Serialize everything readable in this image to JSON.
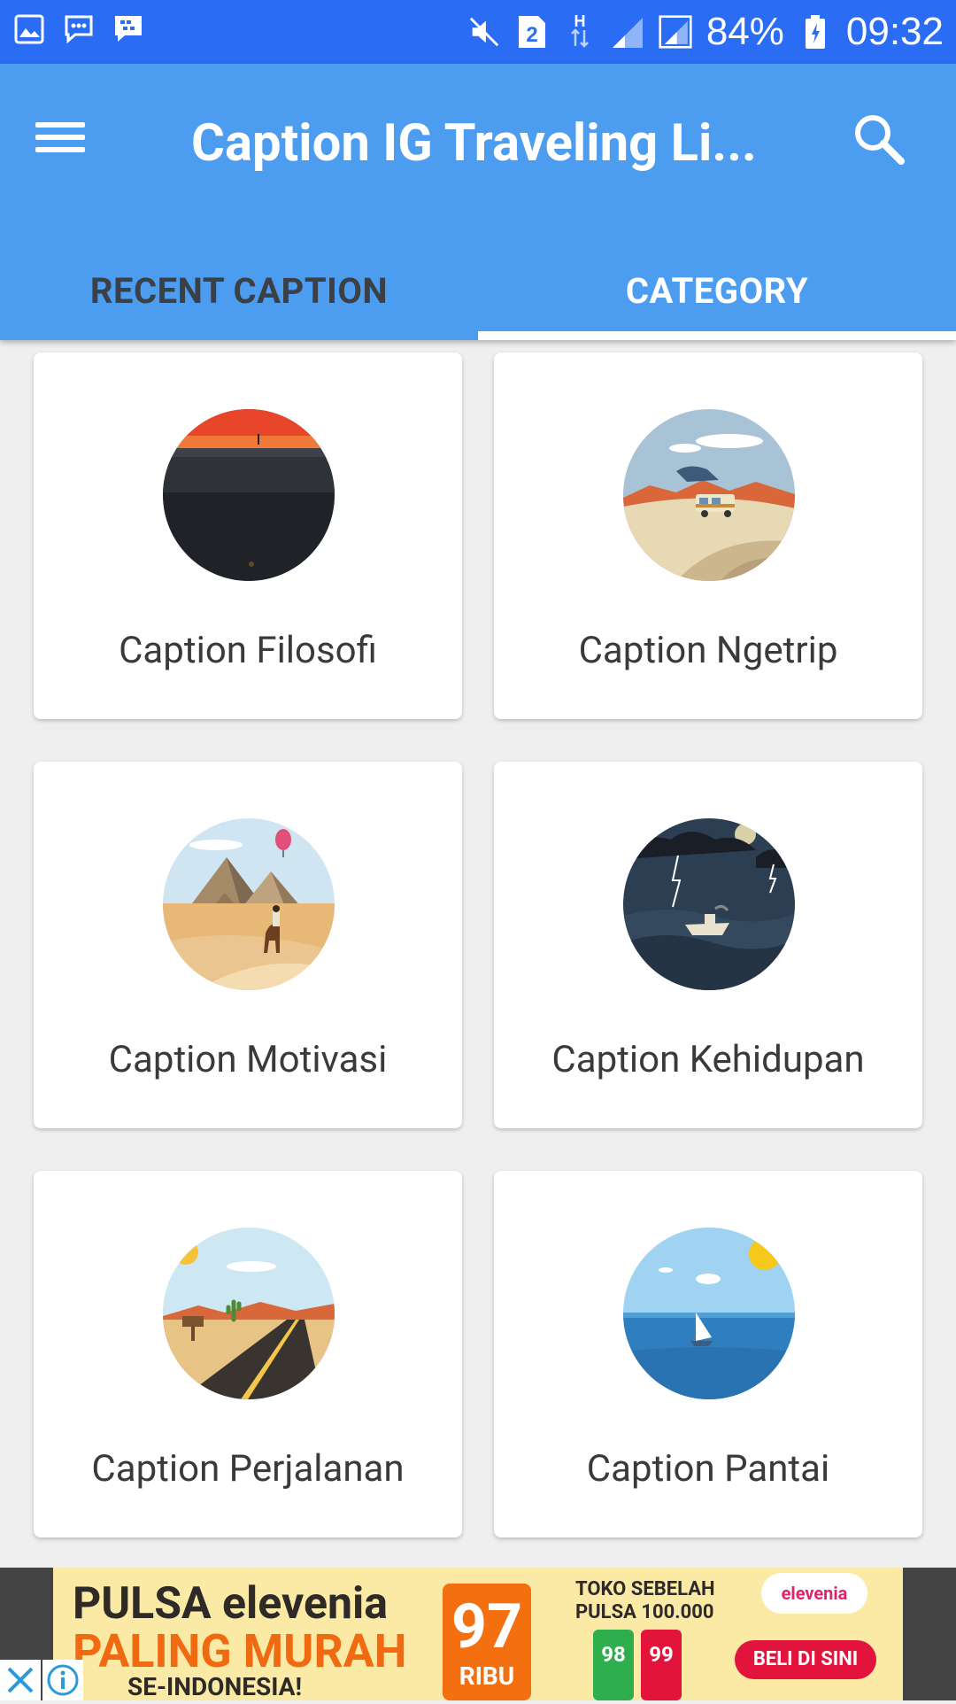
{
  "status_bar": {
    "battery": "84%",
    "time": "09:32",
    "sim_slot": "2",
    "network_type": "H",
    "icons": [
      "gallery-icon",
      "messaging-icon",
      "bbm-icon",
      "mute-icon",
      "sim-icon",
      "data-icon",
      "signal-icon",
      "signal-icon",
      "battery-icon"
    ]
  },
  "app_bar": {
    "title": "Caption IG Traveling Li...",
    "menu_icon": "hamburger-menu-icon",
    "search_icon": "search-icon",
    "tabs": [
      {
        "label": "RECENT CAPTION",
        "active": false
      },
      {
        "label": "CATEGORY",
        "active": true
      }
    ]
  },
  "categories": [
    {
      "label": "Caption Filosofi",
      "image": "sunset-silhouette"
    },
    {
      "label": "Caption Ngetrip",
      "image": "desert-van"
    },
    {
      "label": "Caption Motivasi",
      "image": "pyramids-camel"
    },
    {
      "label": "Caption Kehidupan",
      "image": "storm-boat"
    },
    {
      "label": "Caption Perjalanan",
      "image": "desert-road"
    },
    {
      "label": "Caption Pantai",
      "image": "sea-sailboat"
    }
  ],
  "ad": {
    "line1": "PULSA elevenia",
    "line2": "PALING MURAH",
    "line3": "SE-INDONESIA!",
    "price": "97",
    "price_unit": "RIBU",
    "promo": "TOKO SEBELAH PULSA 100.000",
    "card1": "98",
    "card2": "99",
    "brand": "elevenia",
    "cta": "BELI DI SINI",
    "colors": {
      "background": "#fbe9a6",
      "accent": "#f06a12",
      "cta": "#e3143b"
    }
  },
  "colors": {
    "status_bar": "#2a6df4",
    "app_bar": "#4c9cef",
    "background": "#efefef",
    "card": "#ffffff"
  }
}
